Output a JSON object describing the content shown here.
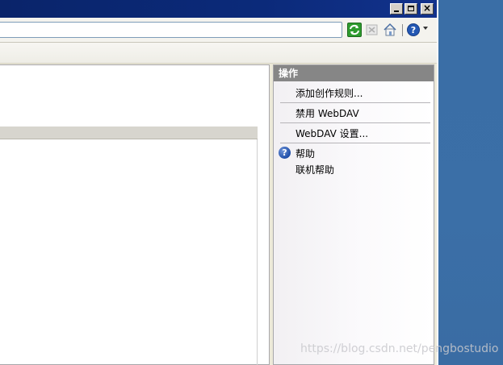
{
  "window": {
    "controls": {
      "minimize": "_",
      "maximize": "□",
      "close": "×"
    }
  },
  "toolbar": {
    "icons": [
      "refresh-icon",
      "stop-icon",
      "home-icon",
      "help-icon",
      "chevron-down-icon"
    ]
  },
  "actions": {
    "header": "操作",
    "items": [
      {
        "label": "添加创作规则..."
      },
      {
        "label": "禁用 WebDAV"
      },
      {
        "label": "WebDAV 设置..."
      }
    ],
    "help": {
      "label": "帮助",
      "icon": "?"
    },
    "online_help": {
      "label": "联机帮助"
    }
  },
  "watermark": "https://blog.csdn.net/pengbostudio",
  "colors": {
    "title_bar": "#0a246a",
    "actions_header": "#868686",
    "desktop": "#3b6ea5"
  }
}
